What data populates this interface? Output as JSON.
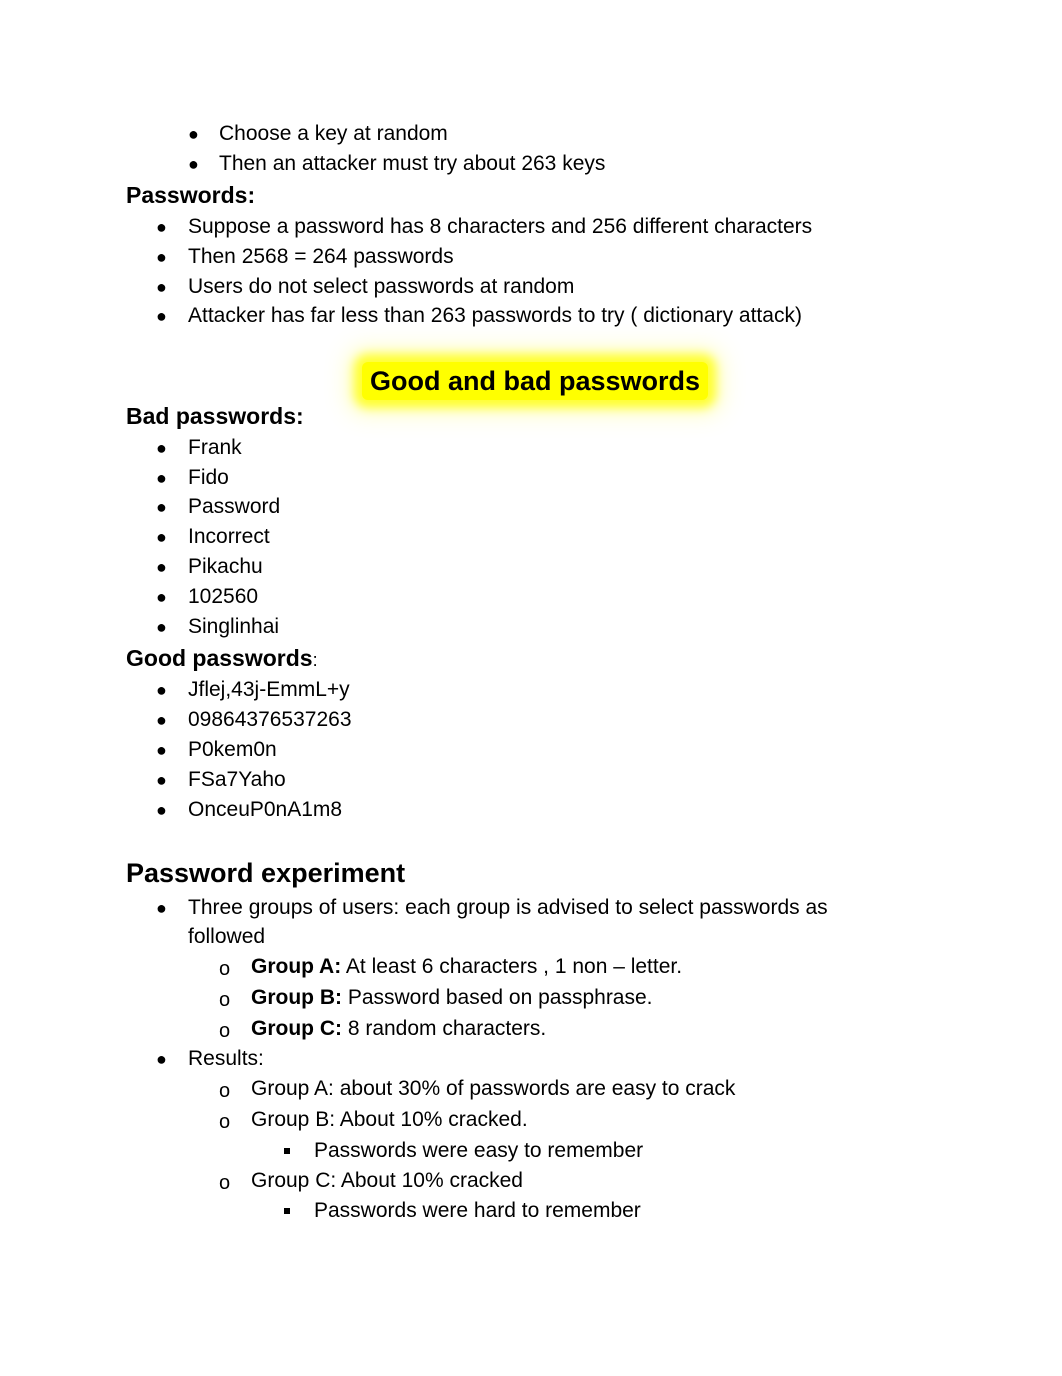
{
  "intro_list": [
    "Choose a key at random",
    "Then an attacker must try about 263 keys"
  ],
  "passwords_section": {
    "heading": "Passwords:",
    "items": [
      "Suppose a password has 8 characters and 256 different characters",
      "Then 2568 = 264 passwords",
      "Users do not select passwords at random",
      "Attacker has far less than 263 passwords to try ( dictionary attack)"
    ]
  },
  "highlight_title": "Good and bad passwords",
  "highlight_color": "#ffff00",
  "bad_passwords": {
    "heading": "Bad passwords:",
    "items": [
      "Frank",
      "Fido",
      "Password",
      "Incorrect",
      "Pikachu",
      "102560",
      "Singlinhai"
    ]
  },
  "good_passwords": {
    "heading": "Good passwords",
    "heading_suffix": ":",
    "items": [
      "Jflej,43j-EmmL+y",
      "09864376537263",
      "P0kem0n",
      "FSa7Yaho",
      "OnceuP0nA1m8"
    ]
  },
  "experiment": {
    "heading": "Password experiment",
    "groups_intro_line1": "Three groups of users: each group is advised to select passwords as",
    "groups_intro_line2": "followed",
    "groups": [
      {
        "label": "Group A:",
        "text": " At least 6 characters , 1 non – letter."
      },
      {
        "label": "Group B:",
        "text": " Password based on passphrase."
      },
      {
        "label": "Group C:",
        "text": " 8 random characters."
      }
    ],
    "results_label": "Results:",
    "results": [
      {
        "text": "Group A: about 30% of passwords are easy to crack"
      },
      {
        "text": "Group B: About 10% cracked.",
        "sub": "Passwords were easy to remember"
      },
      {
        "text": "Group C: About 10% cracked",
        "sub": "Passwords were hard to remember"
      }
    ]
  }
}
